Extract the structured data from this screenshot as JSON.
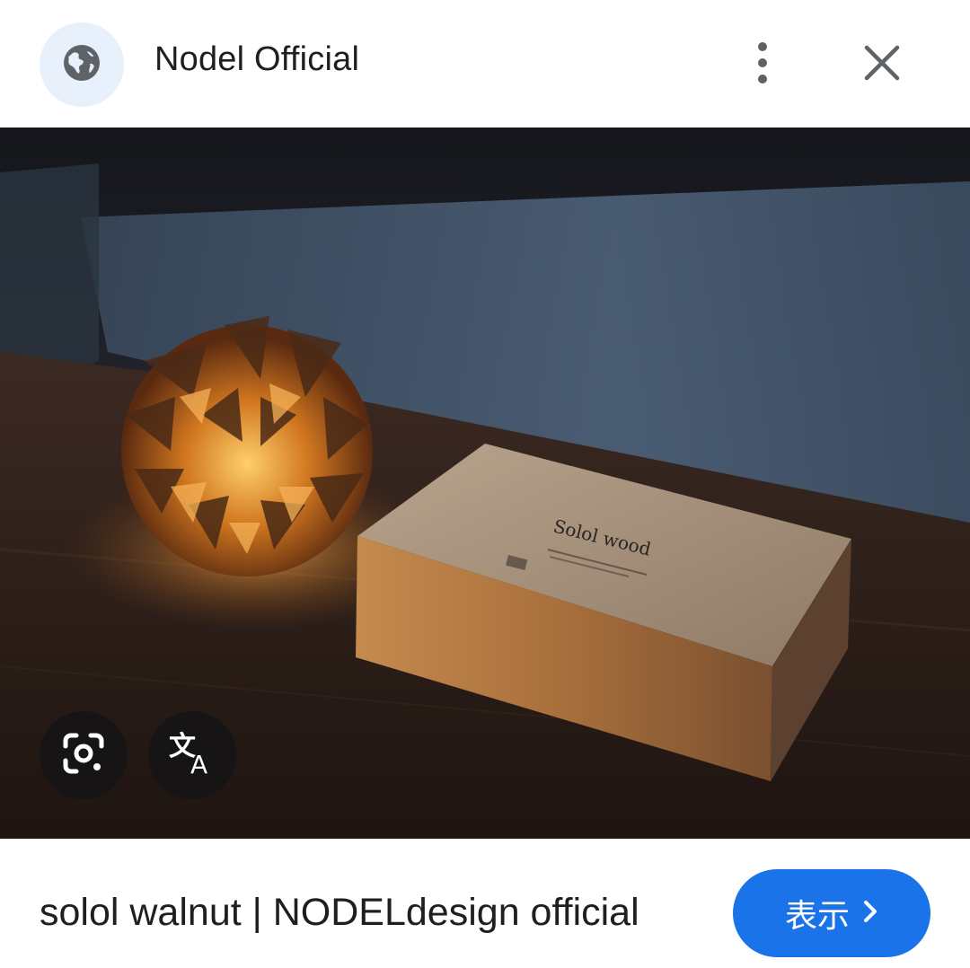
{
  "header": {
    "site_name": "Nodel Official",
    "site_icon": "globe-icon",
    "more_icon": "more-vert-icon",
    "close_icon": "close-icon"
  },
  "image": {
    "box_label": "Solol wood",
    "overlay_buttons": [
      {
        "icon": "google-lens-icon"
      },
      {
        "icon": "translate-icon"
      }
    ]
  },
  "footer": {
    "caption": "solol walnut | NODELdesign official",
    "view_button_label": "表示",
    "view_button_icon": "chevron-right-icon"
  },
  "colors": {
    "accent": "#1a73e8",
    "globe_bg": "#e8f0fb",
    "text": "#1f1f1f"
  }
}
